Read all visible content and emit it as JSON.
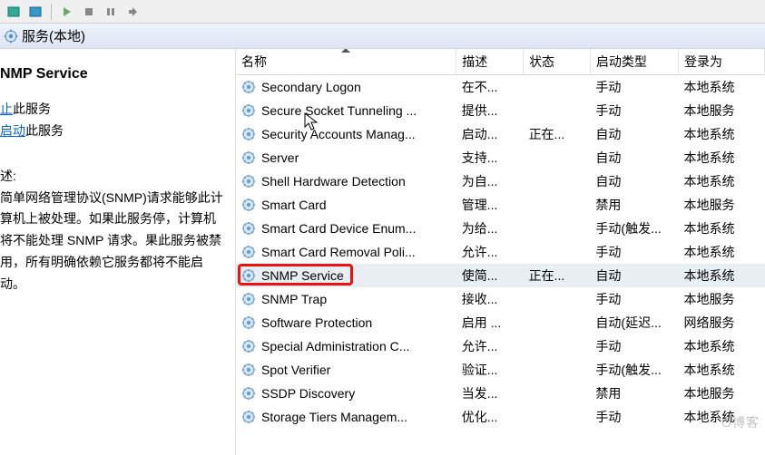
{
  "header": {
    "title": "服务(本地)"
  },
  "left": {
    "title": "NMP Service",
    "stop_prefix": "止",
    "stop_link": "此服务",
    "restart_link": "启动",
    "restart_suffix": "此服务",
    "desc_head": "述:",
    "desc_body": "简单网络管理协议(SNMP)请求能够此计算机上被处理。如果此服务停，计算机将不能处理 SNMP 请求。果此服务被禁用，所有明确依赖它服务都将不能启动。"
  },
  "columns": {
    "name": "名称",
    "desc": "描述",
    "status": "状态",
    "startup": "启动类型",
    "logon": "登录为"
  },
  "services": [
    {
      "name": "Secondary Logon",
      "desc": "在不...",
      "status": "",
      "startup": "手动",
      "logon": "本地系统"
    },
    {
      "name": "Secure Socket Tunneling ...",
      "desc": "提供...",
      "status": "",
      "startup": "手动",
      "logon": "本地服务"
    },
    {
      "name": "Security Accounts Manag...",
      "desc": "启动...",
      "status": "正在...",
      "startup": "自动",
      "logon": "本地系统"
    },
    {
      "name": "Server",
      "desc": "支持...",
      "status": "",
      "startup": "自动",
      "logon": "本地系统"
    },
    {
      "name": "Shell Hardware Detection",
      "desc": "为自...",
      "status": "",
      "startup": "自动",
      "logon": "本地系统"
    },
    {
      "name": "Smart Card",
      "desc": "管理...",
      "status": "",
      "startup": "禁用",
      "logon": "本地服务"
    },
    {
      "name": "Smart Card Device Enum...",
      "desc": "为给...",
      "status": "",
      "startup": "手动(触发...",
      "logon": "本地系统"
    },
    {
      "name": "Smart Card Removal Poli...",
      "desc": "允许...",
      "status": "",
      "startup": "手动",
      "logon": "本地系统"
    },
    {
      "name": "SNMP Service",
      "desc": "使简...",
      "status": "正在...",
      "startup": "自动",
      "logon": "本地系统",
      "selected": true,
      "highlight": true
    },
    {
      "name": "SNMP Trap",
      "desc": "接收...",
      "status": "",
      "startup": "手动",
      "logon": "本地服务"
    },
    {
      "name": "Software Protection",
      "desc": "启用 ...",
      "status": "",
      "startup": "自动(延迟...",
      "logon": "网络服务"
    },
    {
      "name": "Special Administration C...",
      "desc": "允许...",
      "status": "",
      "startup": "手动",
      "logon": "本地系统"
    },
    {
      "name": "Spot Verifier",
      "desc": "验证...",
      "status": "",
      "startup": "手动(触发...",
      "logon": "本地系统"
    },
    {
      "name": "SSDP Discovery",
      "desc": "当发...",
      "status": "",
      "startup": "禁用",
      "logon": "本地服务"
    },
    {
      "name": "Storage Tiers Managem...",
      "desc": "优化...",
      "status": "",
      "startup": "手动",
      "logon": "本地系统"
    }
  ],
  "watermark": "O博客"
}
